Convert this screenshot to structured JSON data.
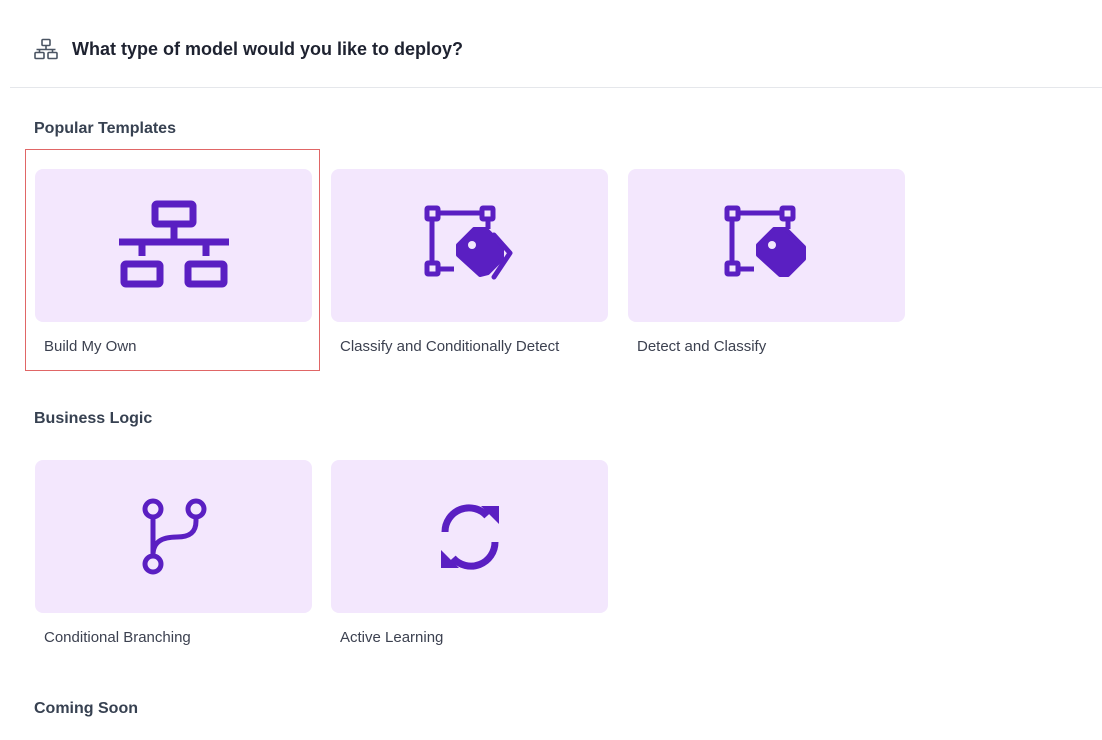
{
  "header": {
    "title": "What type of model would you like to deploy?",
    "icon": "sitemap-icon"
  },
  "colors": {
    "accent": "#5a1fc2",
    "tile_background": "#f3e7fd",
    "selection_border": "#e06666",
    "divider": "#e5e7eb"
  },
  "sections": [
    {
      "title": "Popular Templates",
      "cards": [
        {
          "label": "Build My Own",
          "icon": "sitemap-icon",
          "selected": true
        },
        {
          "label": "Classify and Conditionally Detect",
          "icon": "detect-tags-icon",
          "selected": false
        },
        {
          "label": "Detect and Classify",
          "icon": "detect-tag-icon",
          "selected": false
        }
      ]
    },
    {
      "title": "Business Logic",
      "cards": [
        {
          "label": "Conditional Branching",
          "icon": "code-branch-icon",
          "selected": false
        },
        {
          "label": "Active Learning",
          "icon": "refresh-icon",
          "selected": false
        }
      ]
    },
    {
      "title": "Coming Soon",
      "cards": []
    }
  ]
}
